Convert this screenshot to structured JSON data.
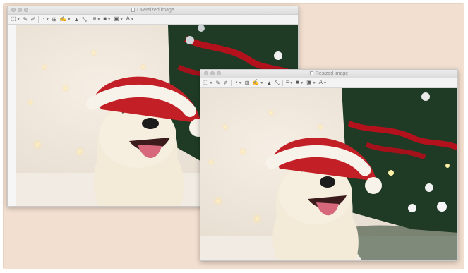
{
  "windows": [
    {
      "title": "Oversized image"
    },
    {
      "title": "Resized image"
    }
  ],
  "toolbar": {
    "tools": [
      {
        "icon": "selection-rect-icon",
        "glyph": "⬚",
        "dropdown": true
      },
      {
        "icon": "instant-alpha-icon",
        "glyph": "✎",
        "dropdown": false
      },
      {
        "icon": "sketch-icon",
        "glyph": "✐",
        "dropdown": false
      },
      {
        "icon": "shapes-icon",
        "glyph": "◔",
        "dropdown": true
      },
      {
        "icon": "text-icon",
        "glyph": "⊞",
        "dropdown": false
      },
      {
        "icon": "sign-icon",
        "glyph": "✍",
        "dropdown": true
      },
      {
        "icon": "adjust-color-icon",
        "glyph": "▲",
        "dropdown": false
      },
      {
        "icon": "adjust-size-icon",
        "glyph": "⤡",
        "dropdown": false
      },
      {
        "icon": "shape-style-icon",
        "glyph": "≡",
        "dropdown": true
      },
      {
        "icon": "border-color-icon",
        "glyph": "■",
        "dropdown": true
      },
      {
        "icon": "fill-color-icon",
        "glyph": "▣",
        "dropdown": true
      },
      {
        "icon": "text-style-icon",
        "glyph": "A",
        "dropdown": true
      }
    ]
  },
  "colors": {
    "backdrop": "#f2dfcf",
    "hat_red": "#c21f26",
    "tree_green": "#1f3b25",
    "dog_cream": "#f3ead8"
  }
}
